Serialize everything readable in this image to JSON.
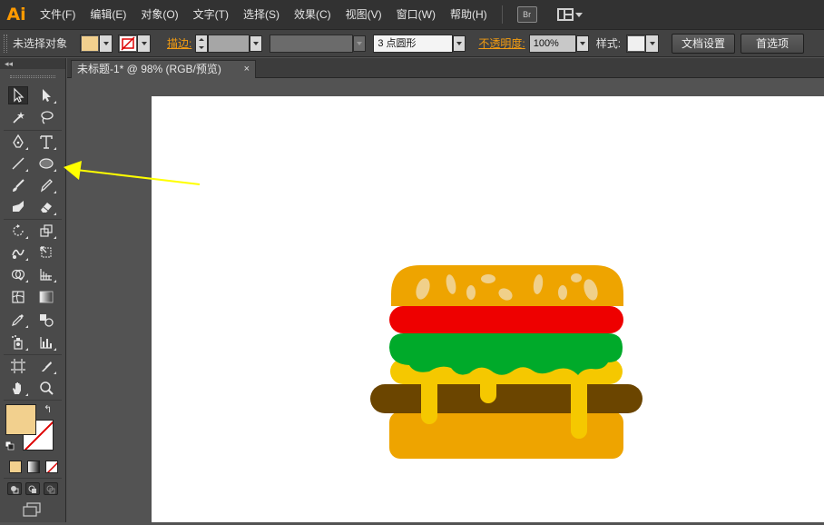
{
  "app": {
    "logo": "Ai"
  },
  "menu": {
    "items": [
      "文件(F)",
      "编辑(E)",
      "对象(O)",
      "文字(T)",
      "选择(S)",
      "效果(C)",
      "视图(V)",
      "窗口(W)",
      "帮助(H)"
    ],
    "bridge_label": "Br"
  },
  "control": {
    "selection_status": "未选择对象",
    "fill_color": "#f2d08e",
    "stroke_label": "描边:",
    "brush_value": "3 点圆形",
    "opacity_label": "不透明度:",
    "opacity_value": "100%",
    "style_label": "样式:",
    "doc_setup_button": "文档设置",
    "preferences_button": "首选项"
  },
  "tools": {
    "collapse_label": "◂◂",
    "icons": [
      "selection-tool-icon",
      "direct-selection-tool-icon",
      "magic-wand-tool-icon",
      "lasso-tool-icon",
      "pen-tool-icon",
      "type-tool-icon",
      "line-segment-tool-icon",
      "ellipse-tool-icon",
      "paintbrush-tool-icon",
      "pencil-tool-icon",
      "blob-brush-tool-icon",
      "eraser-tool-icon",
      "rotate-tool-icon",
      "scale-tool-icon",
      "warp-tool-icon",
      "free-transform-tool-icon",
      "shape-builder-tool-icon",
      "perspective-grid-tool-icon",
      "mesh-tool-icon",
      "gradient-tool-icon",
      "eyedropper-tool-icon",
      "blend-tool-icon",
      "symbol-sprayer-tool-icon",
      "column-graph-tool-icon",
      "artboard-tool-icon",
      "slice-tool-icon",
      "hand-tool-icon",
      "zoom-tool-icon"
    ],
    "fill_swatch_color": "#f2d08e",
    "stroke_swatch_color": "#ffffff"
  },
  "document": {
    "tab_title": "未标题-1* @ 98% (RGB/预览)",
    "close_glyph": "×"
  },
  "artwork": {
    "colors": {
      "bun": "#eea400",
      "sesame": "#f0d08a",
      "tomato": "#ee0000",
      "lettuce": "#00aa2a",
      "cheese": "#f5c800",
      "patty": "#6b4500"
    }
  },
  "annotation": {
    "arrow_color": "#ffff00"
  }
}
